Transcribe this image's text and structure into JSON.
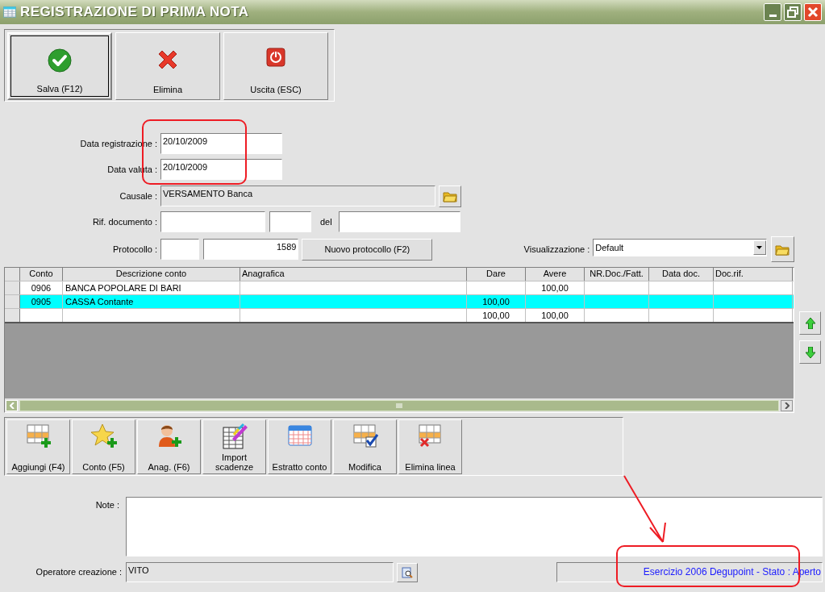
{
  "window": {
    "title": "REGISTRAZIONE DI PRIMA NOTA"
  },
  "toolbar": [
    {
      "label": "Salva (F12)",
      "kind": "check",
      "focused": true
    },
    {
      "label": "Elimina",
      "kind": "cross",
      "focused": false
    },
    {
      "label": "Uscita (ESC)",
      "kind": "power",
      "focused": false
    }
  ],
  "form": {
    "data_registrazione": {
      "label": "Data registrazione :",
      "value": "20/10/2009"
    },
    "data_valuta": {
      "label": "Data valuta :",
      "value": "20/10/2009"
    },
    "causale": {
      "label": "Causale :",
      "value": "VERSAMENTO Banca",
      "disabled": true
    },
    "rif_documento": {
      "label": "Rif. documento :",
      "del_label": "del"
    },
    "protocollo": {
      "label": "Protocollo :",
      "number": "1589",
      "button": "Nuovo protocollo (F2)"
    },
    "visualizzazione": {
      "label": "Visualizzazione :",
      "value": "Default"
    }
  },
  "table": {
    "columns": [
      {
        "kind": "conto",
        "label": "Conto"
      },
      {
        "kind": "descrizione",
        "label": "Descrizione conto"
      },
      {
        "kind": "anagrafica",
        "label": "Anagrafica"
      },
      {
        "kind": "dare",
        "label": "Dare"
      },
      {
        "kind": "avere",
        "label": "Avere"
      },
      {
        "kind": "nr_doc",
        "label": "NR.Doc./Fatt."
      },
      {
        "kind": "data_doc",
        "label": "Data doc."
      },
      {
        "kind": "doc_rif",
        "label": "Doc.rif."
      }
    ],
    "rows": [
      {
        "conto": "0906",
        "descrizione": "BANCA POPOLARE DI BARI",
        "avere": "100,00",
        "selected": false
      },
      {
        "conto": "0905",
        "descrizione": "CASSA Contante",
        "dare": "100,00",
        "selected": true
      },
      {
        "dare": "100,00",
        "avere": "100,00",
        "selected": false
      }
    ]
  },
  "line_toolbar": [
    {
      "label": "Aggiungi (F4)",
      "kind": "grid-add"
    },
    {
      "label": "Conto (F5)",
      "kind": "star-add"
    },
    {
      "label": "Anag. (F6)",
      "kind": "person-add"
    },
    {
      "label": "Import scadenze",
      "kind": "report"
    },
    {
      "label": "Estratto conto",
      "kind": "calendar"
    },
    {
      "label": "Modifica",
      "kind": "grid-check"
    },
    {
      "label": "Elimina linea",
      "kind": "grid-delete"
    }
  ],
  "note": {
    "label": "Note :"
  },
  "operatore": {
    "label": "Operatore creazione :",
    "value": "VITO",
    "disabled": true
  },
  "status": {
    "text": "Esercizio 2006 Degupoint - Stato : Aperto"
  }
}
